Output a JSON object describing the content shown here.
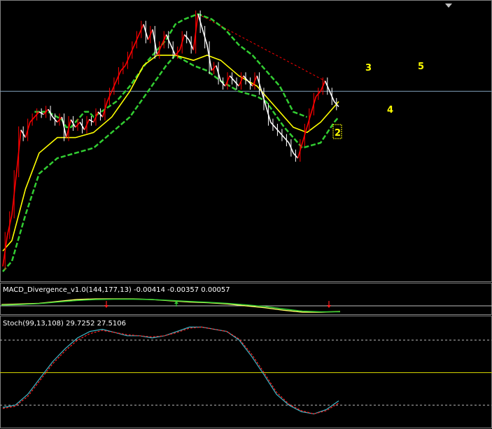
{
  "colors": {
    "background": "#000000",
    "border": "#808080",
    "price_up": "#ff0000",
    "price_down": "#ffffff",
    "ma": "#ffff00",
    "envelope": "#32cd32",
    "hline": "#7f9fb8",
    "trend_dash": "#ff0000",
    "macd_main": "#ffff66",
    "macd_signal": "#32cd32",
    "stoch_main": "#3fb8c8",
    "stoch_signal": "#ff2020",
    "stoch_level_dash": "#bbbbbb",
    "stoch_mid": "#d4d400",
    "wave_label": "#ffff00",
    "arrow_red": "#ff2020",
    "arrow_green": "#32cd32",
    "macd_zero": "#bbbbbb"
  },
  "panels": {
    "macd": {
      "label": "MACD_Divergence_v1.0(144,177,13) -0.00414 -0.00357 0.00057"
    },
    "stoch": {
      "label": "Stoch(99,13,108) 29.7252 27.5106"
    }
  },
  "chart_data": [
    {
      "type": "line",
      "name": "price",
      "y_range": [
        0,
        100
      ],
      "x_range": [
        0,
        100
      ],
      "series": [
        {
          "role": "price",
          "points": [
            [
              0,
              2
            ],
            [
              1,
              14
            ],
            [
              2,
              22
            ],
            [
              3,
              38
            ],
            [
              4,
              55
            ],
            [
              5,
              52
            ],
            [
              6,
              58
            ],
            [
              7,
              60
            ],
            [
              8,
              62
            ],
            [
              9,
              61
            ],
            [
              10,
              63
            ],
            [
              11,
              60
            ],
            [
              12,
              58
            ],
            [
              13,
              60
            ],
            [
              14,
              52
            ],
            [
              15,
              59
            ],
            [
              16,
              56
            ],
            [
              17,
              58
            ],
            [
              18,
              55
            ],
            [
              19,
              59
            ],
            [
              20,
              58
            ],
            [
              21,
              62
            ],
            [
              22,
              60
            ],
            [
              23,
              66
            ],
            [
              24,
              70
            ],
            [
              25,
              74
            ],
            [
              26,
              78
            ],
            [
              27,
              80
            ],
            [
              28,
              84
            ],
            [
              29,
              88
            ],
            [
              30,
              92
            ],
            [
              31,
              96
            ],
            [
              32,
              90
            ],
            [
              33,
              94
            ],
            [
              34,
              84
            ],
            [
              35,
              88
            ],
            [
              36,
              92
            ],
            [
              37,
              88
            ],
            [
              38,
              84
            ],
            [
              39,
              86
            ],
            [
              40,
              92
            ],
            [
              41,
              90
            ],
            [
              42,
              86
            ],
            [
              43,
              100
            ],
            [
              44,
              94
            ],
            [
              45,
              88
            ],
            [
              46,
              78
            ],
            [
              47,
              80
            ],
            [
              48,
              74
            ],
            [
              49,
              72
            ],
            [
              50,
              76
            ],
            [
              51,
              74
            ],
            [
              52,
              72
            ],
            [
              53,
              76
            ],
            [
              54,
              74
            ],
            [
              55,
              72
            ],
            [
              56,
              76
            ],
            [
              57,
              70
            ],
            [
              58,
              64
            ],
            [
              59,
              58
            ],
            [
              60,
              56
            ],
            [
              61,
              54
            ],
            [
              62,
              52
            ],
            [
              63,
              50
            ],
            [
              64,
              46
            ],
            [
              65,
              44
            ],
            [
              66,
              50
            ],
            [
              67,
              56
            ],
            [
              68,
              62
            ],
            [
              69,
              68
            ],
            [
              70,
              70
            ],
            [
              71,
              74
            ],
            [
              72,
              70
            ],
            [
              73,
              66
            ],
            [
              74,
              64
            ]
          ]
        },
        {
          "role": "ma",
          "points": [
            [
              0,
              8
            ],
            [
              2,
              12
            ],
            [
              5,
              32
            ],
            [
              8,
              46
            ],
            [
              12,
              52
            ],
            [
              16,
              52
            ],
            [
              20,
              54
            ],
            [
              24,
              60
            ],
            [
              28,
              70
            ],
            [
              31,
              80
            ],
            [
              34,
              84
            ],
            [
              38,
              84
            ],
            [
              42,
              82
            ],
            [
              45,
              84
            ],
            [
              48,
              82
            ],
            [
              52,
              76
            ],
            [
              56,
              72
            ],
            [
              60,
              64
            ],
            [
              64,
              56
            ],
            [
              67,
              54
            ],
            [
              70,
              58
            ],
            [
              73,
              64
            ],
            [
              74,
              66
            ]
          ]
        },
        {
          "role": "envelope_upper",
          "points": [
            [
              7,
              62
            ],
            [
              10,
              62
            ],
            [
              12,
              60
            ],
            [
              13,
              59
            ],
            [
              14,
              56
            ],
            [
              15,
              56
            ],
            [
              16,
              58
            ],
            [
              17,
              60
            ],
            [
              18,
              62
            ],
            [
              19,
              62
            ],
            [
              20,
              60
            ],
            [
              25,
              66
            ],
            [
              28,
              72
            ],
            [
              32,
              82
            ],
            [
              36,
              90
            ],
            [
              38,
              96
            ],
            [
              40,
              98
            ],
            [
              43,
              100
            ],
            [
              46,
              98
            ],
            [
              49,
              94
            ],
            [
              52,
              88
            ],
            [
              55,
              84
            ],
            [
              58,
              78
            ],
            [
              61,
              72
            ],
            [
              64,
              62
            ],
            [
              67,
              60
            ]
          ]
        },
        {
          "role": "envelope_lower",
          "points": [
            [
              0,
              0
            ],
            [
              2,
              4
            ],
            [
              5,
              22
            ],
            [
              8,
              38
            ],
            [
              12,
              44
            ],
            [
              16,
              46
            ],
            [
              20,
              48
            ],
            [
              24,
              54
            ],
            [
              28,
              60
            ],
            [
              32,
              70
            ],
            [
              36,
              80
            ],
            [
              38,
              84
            ],
            [
              42,
              80
            ],
            [
              45,
              78
            ],
            [
              48,
              74
            ],
            [
              52,
              70
            ],
            [
              56,
              68
            ],
            [
              58,
              66
            ],
            [
              62,
              56
            ],
            [
              66,
              48
            ],
            [
              70,
              50
            ],
            [
              73,
              58
            ],
            [
              74,
              60
            ]
          ]
        },
        {
          "role": "trend_dash",
          "points": [
            [
              43,
              100
            ],
            [
              71,
              74
            ]
          ]
        },
        {
          "role": "hline",
          "y": 70
        }
      ],
      "wave_labels": [
        "2",
        "3",
        "4",
        "5"
      ]
    },
    {
      "type": "line",
      "name": "macd",
      "series": [
        {
          "name": "main",
          "values": [
            0.1,
            0.15,
            0.2,
            0.35,
            0.5,
            0.55,
            0.55,
            0.55,
            0.5,
            0.4,
            0.3,
            0.25,
            0.15,
            0.0,
            -0.15,
            -0.35,
            -0.5,
            -0.5,
            -0.45
          ]
        },
        {
          "name": "signal",
          "values": [
            0.05,
            0.1,
            0.18,
            0.3,
            0.42,
            0.5,
            0.52,
            0.53,
            0.5,
            0.43,
            0.35,
            0.28,
            0.2,
            0.08,
            -0.05,
            -0.25,
            -0.42,
            -0.48,
            -0.47
          ]
        }
      ]
    },
    {
      "type": "line",
      "name": "stoch",
      "levels": [
        80,
        50,
        20
      ],
      "series": [
        {
          "name": "main",
          "values": [
            18,
            20,
            30,
            45,
            60,
            72,
            82,
            88,
            90,
            87,
            84,
            84,
            82,
            84,
            88,
            92,
            92,
            90,
            88,
            80,
            65,
            48,
            30,
            20,
            14,
            12,
            16,
            24
          ]
        },
        {
          "name": "signal",
          "values": [
            17,
            19,
            28,
            43,
            58,
            70,
            80,
            86,
            89,
            87,
            85,
            84,
            83,
            84,
            87,
            91,
            92,
            90,
            88,
            81,
            67,
            50,
            32,
            21,
            15,
            12,
            15,
            22
          ]
        }
      ]
    }
  ]
}
